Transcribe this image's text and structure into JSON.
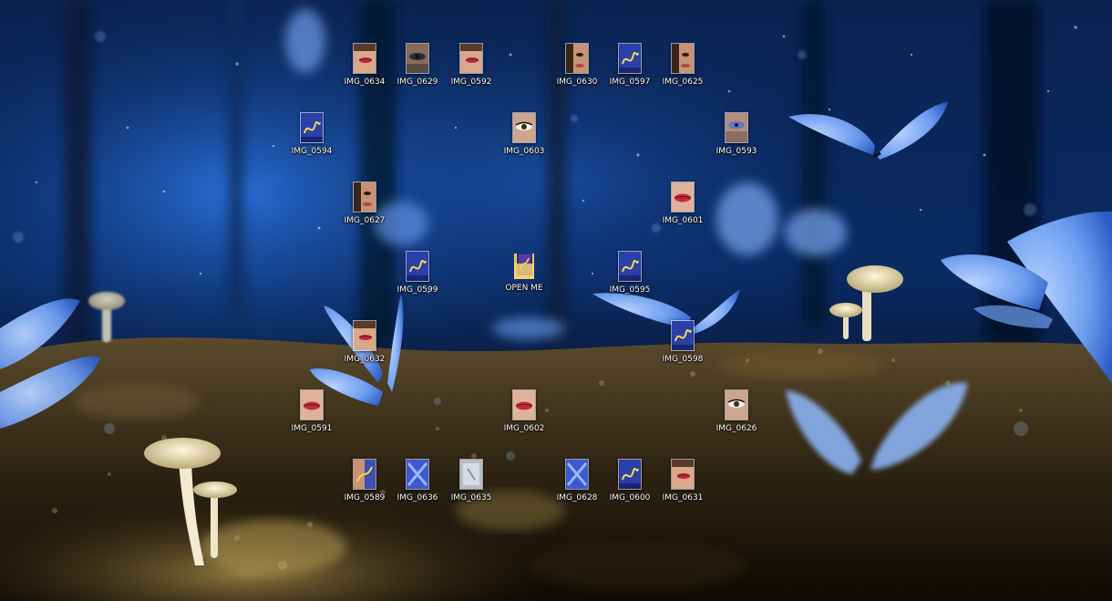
{
  "desktop": {
    "icons": [
      {
        "id": "img0634",
        "label": "IMG_0634",
        "kind": "face-lips"
      },
      {
        "id": "img0629",
        "label": "IMG_0629",
        "kind": "eye-dark"
      },
      {
        "id": "img0592",
        "label": "IMG_0592",
        "kind": "face-lips"
      },
      {
        "id": "img0630",
        "label": "IMG_0630",
        "kind": "face-skin"
      },
      {
        "id": "img0597",
        "label": "IMG_0597",
        "kind": "blue-script"
      },
      {
        "id": "img0625",
        "label": "IMG_0625",
        "kind": "face-skin"
      },
      {
        "id": "img0594",
        "label": "IMG_0594",
        "kind": "blue-script"
      },
      {
        "id": "img0603",
        "label": "IMG_0603",
        "kind": "eye"
      },
      {
        "id": "img0593",
        "label": "IMG_0593",
        "kind": "eye-blue"
      },
      {
        "id": "img0627",
        "label": "IMG_0627",
        "kind": "face-skin"
      },
      {
        "id": "img0601",
        "label": "IMG_0601",
        "kind": "lips"
      },
      {
        "id": "img0599",
        "label": "IMG_0599",
        "kind": "blue-script"
      },
      {
        "id": "openme",
        "label": "OPEN ME",
        "kind": "folder"
      },
      {
        "id": "img0595",
        "label": "IMG_0595",
        "kind": "blue-script"
      },
      {
        "id": "img0632",
        "label": "IMG_0632",
        "kind": "face-lips"
      },
      {
        "id": "img0598",
        "label": "IMG_0598",
        "kind": "blue-script"
      },
      {
        "id": "img0591",
        "label": "IMG_0591",
        "kind": "lips"
      },
      {
        "id": "img0602",
        "label": "IMG_0602",
        "kind": "lips"
      },
      {
        "id": "img0626",
        "label": "IMG_0626",
        "kind": "eye"
      },
      {
        "id": "img0589",
        "label": "IMG_0589",
        "kind": "blue-mix"
      },
      {
        "id": "img0636",
        "label": "IMG_0636",
        "kind": "blue-x"
      },
      {
        "id": "img0635",
        "label": "IMG_0635",
        "kind": "grey"
      },
      {
        "id": "img0628",
        "label": "IMG_0628",
        "kind": "blue-x"
      },
      {
        "id": "img0600",
        "label": "IMG_0600",
        "kind": "blue-script"
      },
      {
        "id": "img0631",
        "label": "IMG_0631",
        "kind": "face-lips"
      }
    ]
  },
  "colors": {
    "sky_top": "#0a1c3c",
    "sky_bright": "#1f5fc4",
    "butterfly": "#8fb8f5",
    "ground": "#3a2a12"
  }
}
